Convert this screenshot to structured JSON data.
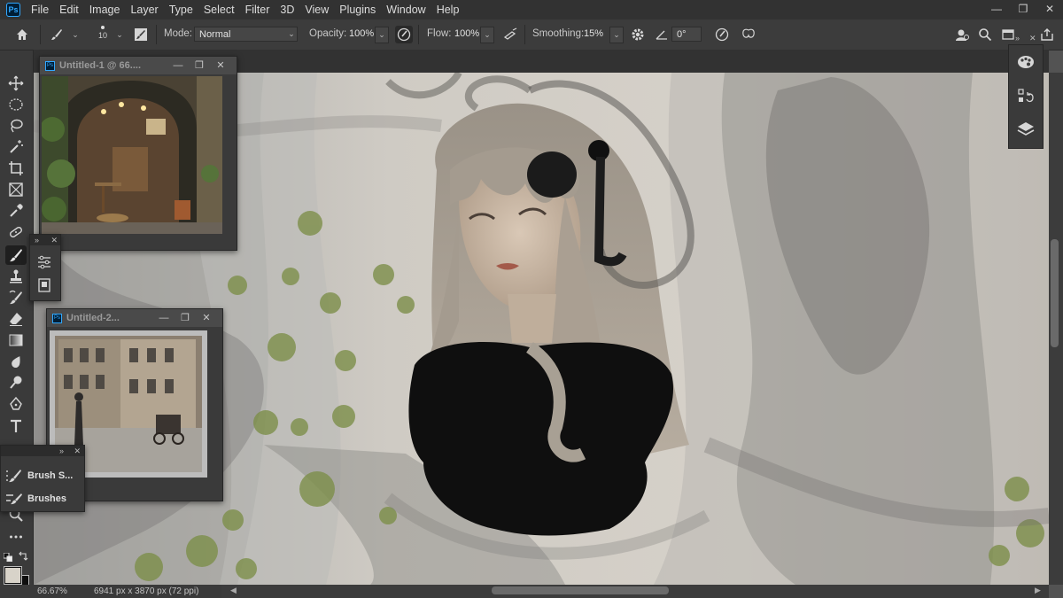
{
  "app": {
    "logo": "Ps"
  },
  "menu": [
    "File",
    "Edit",
    "Image",
    "Layer",
    "Type",
    "Select",
    "Filter",
    "3D",
    "View",
    "Plugins",
    "Window",
    "Help"
  ],
  "window_controls": {
    "minimize": "—",
    "restore": "❐",
    "close": "✕"
  },
  "options": {
    "brush_size": "10",
    "mode_label": "Mode:",
    "mode_value": "Normal",
    "opacity_label": "Opacity:",
    "opacity_value": "100%",
    "flow_label": "Flow:",
    "flow_value": "100%",
    "smoothing_label": "Smoothing:",
    "smoothing_value": "15%",
    "angle_value": "0°"
  },
  "doc1": {
    "title": "Untitled-1 @ 66...."
  },
  "doc2": {
    "title": "Untitled-2..."
  },
  "panels": {
    "collapse": "»",
    "close": "✕",
    "brush_settings": "Brush S...",
    "brushes": "Brushes"
  },
  "status": {
    "zoom": "66.67%",
    "dimensions": "6941 px x 3870 px (72 ppi)"
  },
  "icons": {
    "home": "home-icon",
    "brush": "brush-icon",
    "move": "move-icon",
    "marquee": "ellipse-marquee-icon",
    "lasso": "lasso-icon",
    "wand": "magic-wand-icon",
    "crop": "crop-icon",
    "frame": "frame-icon",
    "eyedropper": "eyedropper-icon",
    "healing": "healing-icon",
    "stamp": "clone-stamp-icon",
    "history": "history-brush-icon",
    "eraser": "eraser-icon",
    "gradient": "gradient-icon",
    "blur": "blur-icon",
    "dodge": "dodge-icon",
    "pen": "pen-icon",
    "type": "type-icon",
    "zoom": "zoom-icon",
    "more": "more-icon"
  },
  "colors": {
    "foreground": "#171717",
    "background": "#f2f2f2",
    "accent": "#31a8ff"
  }
}
